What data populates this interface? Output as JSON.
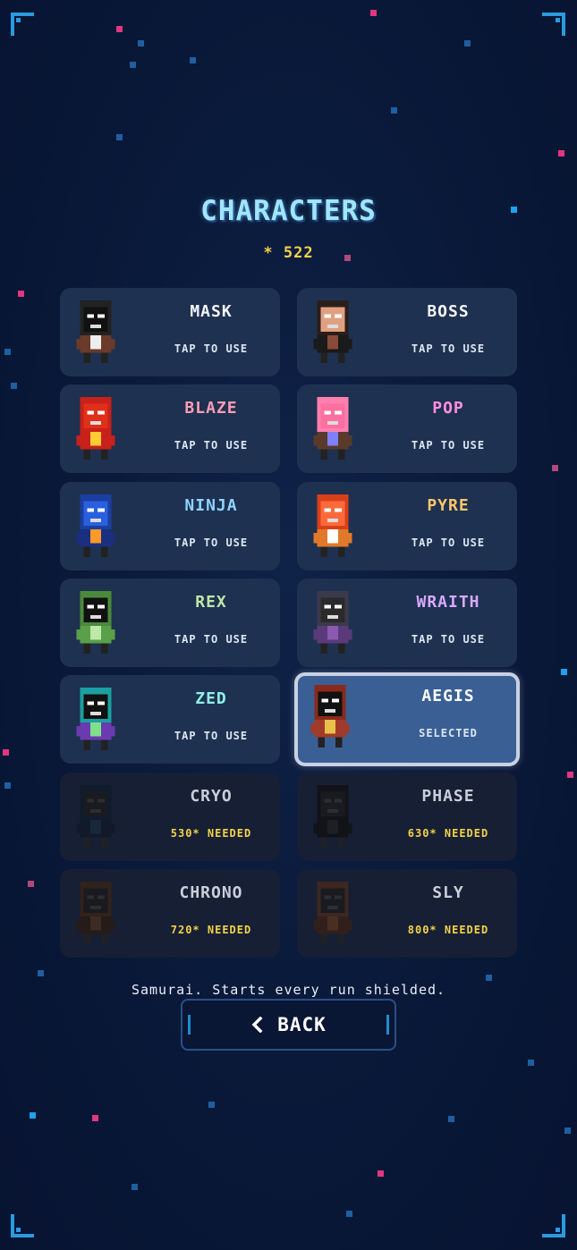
{
  "title": "CHARACTERS",
  "coins": "* 522",
  "characters": [
    {
      "name": "MASK",
      "status": "TAP TO USE",
      "color": "#f4f6fb",
      "locked": false,
      "icon": "mask-character-icon"
    },
    {
      "name": "BOSS",
      "status": "TAP TO USE",
      "color": "#f4f6fb",
      "locked": false,
      "icon": "boss-character-icon"
    },
    {
      "name": "BLAZE",
      "status": "TAP TO USE",
      "color": "#ff9db2",
      "locked": false,
      "icon": "blaze-character-icon"
    },
    {
      "name": "POP",
      "status": "TAP TO USE",
      "color": "#ff8fe0",
      "locked": false,
      "icon": "pop-character-icon"
    },
    {
      "name": "NINJA",
      "status": "TAP TO USE",
      "color": "#8fd3ff",
      "locked": false,
      "icon": "ninja-character-icon"
    },
    {
      "name": "PYRE",
      "status": "TAP TO USE",
      "color": "#ffc76a",
      "locked": false,
      "icon": "pyre-character-icon"
    },
    {
      "name": "REX",
      "status": "TAP TO USE",
      "color": "#bde8a6",
      "locked": false,
      "icon": "rex-character-icon"
    },
    {
      "name": "WRAITH",
      "status": "TAP TO USE",
      "color": "#d8a9ff",
      "locked": false,
      "icon": "wraith-character-icon"
    },
    {
      "name": "ZED",
      "status": "TAP TO USE",
      "color": "#8ff0e6",
      "locked": false,
      "icon": "zed-character-icon"
    },
    {
      "name": "AEGIS",
      "status": "SELECTED",
      "color": "#ffffff",
      "locked": false,
      "selected": true,
      "icon": "aegis-character-icon"
    },
    {
      "name": "CRYO",
      "status": "530* NEEDED",
      "color": "#c9cfd9",
      "locked": true,
      "icon": "cryo-character-icon"
    },
    {
      "name": "PHASE",
      "status": "630* NEEDED",
      "color": "#c9cfd9",
      "locked": true,
      "icon": "phase-character-icon"
    },
    {
      "name": "CHRONO",
      "status": "720* NEEDED",
      "color": "#c9cfd9",
      "locked": true,
      "icon": "chrono-character-icon"
    },
    {
      "name": "SLY",
      "status": "800* NEEDED",
      "color": "#c9cfd9",
      "locked": true,
      "icon": "sly-character-icon"
    }
  ],
  "description": "Samurai. Starts every run shielded.",
  "back_label": "BACK",
  "back_icon": "chevron-left-icon"
}
